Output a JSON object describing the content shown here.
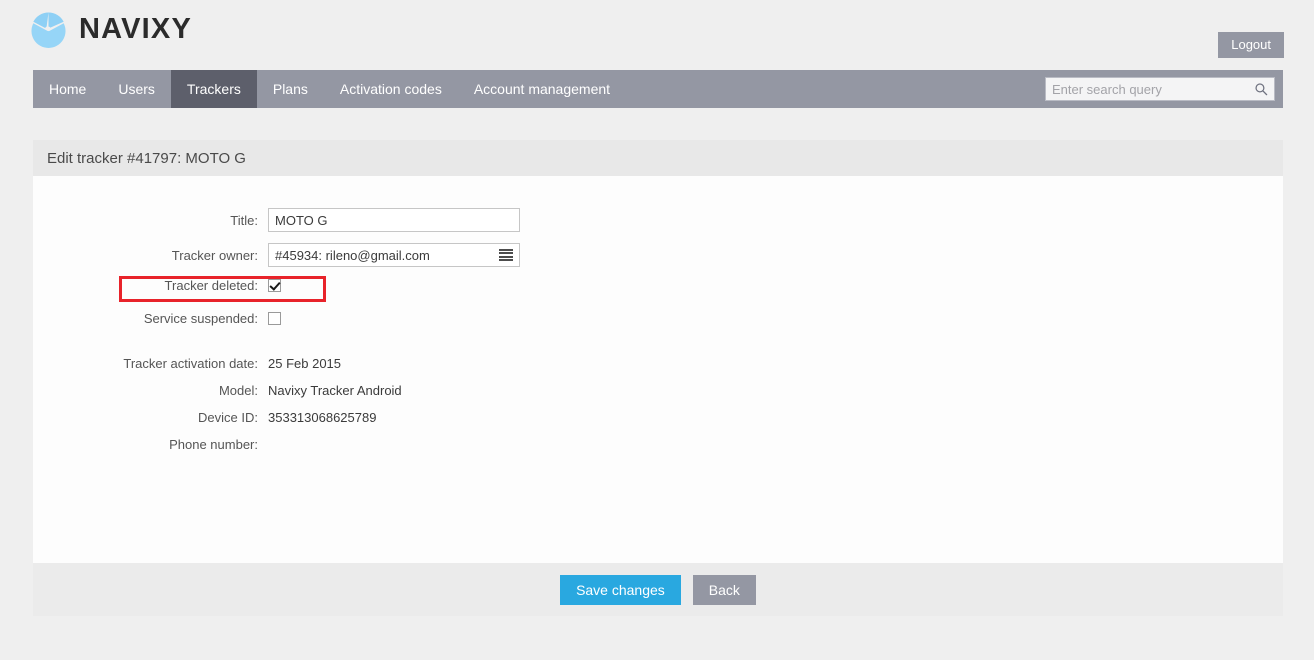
{
  "brand": {
    "name": "NAVIXY",
    "logo_icon": "navixy-logo-icon",
    "logo_color": "#8ed0f5"
  },
  "topbar": {
    "logout_label": "Logout"
  },
  "nav": {
    "items": [
      {
        "label": "Home",
        "active": false
      },
      {
        "label": "Users",
        "active": false
      },
      {
        "label": "Trackers",
        "active": true
      },
      {
        "label": "Plans",
        "active": false
      },
      {
        "label": "Activation codes",
        "active": false
      },
      {
        "label": "Account management",
        "active": false
      }
    ],
    "active_bg": "#5d5f6b",
    "bar_bg": "#9497a3"
  },
  "search": {
    "placeholder": "Enter search query",
    "value": "",
    "icon": "search-icon"
  },
  "page": {
    "title": "Edit tracker #41797: MOTO G"
  },
  "form": {
    "title": {
      "label": "Title:",
      "value": "MOTO G"
    },
    "owner": {
      "label": "Tracker owner:",
      "value": "#45934: rileno@gmail.com",
      "icon": "hamburger-icon"
    },
    "tracker_deleted": {
      "label": "Tracker deleted:",
      "checked": true,
      "highlighted": true,
      "highlight_color": "#e8232a"
    },
    "service_suspended": {
      "label": "Service suspended:",
      "checked": false
    }
  },
  "info": [
    {
      "label": "Tracker activation date:",
      "value": "25 Feb 2015"
    },
    {
      "label": "Model:",
      "value": "Navixy Tracker Android"
    },
    {
      "label": "Device ID:",
      "value": "353313068625789"
    },
    {
      "label": "Phone number:",
      "value": ""
    }
  ],
  "footer": {
    "save_label": "Save changes",
    "back_label": "Back",
    "save_color": "#29a8e0",
    "back_color": "#9497a3"
  }
}
